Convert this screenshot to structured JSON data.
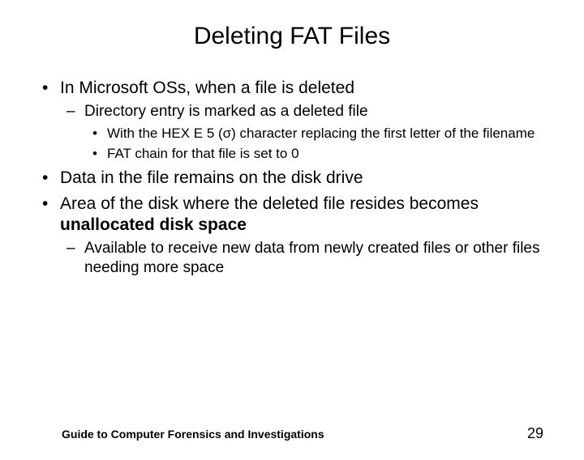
{
  "title": "Deleting FAT Files",
  "bullets": {
    "b1": "In Microsoft OSs, when a file is deleted",
    "b1a": "Directory entry is marked as a deleted file",
    "b1a1": "With the HEX E 5 (σ) character replacing the first letter of the filename",
    "b1a2": "FAT chain for that file is set to 0",
    "b2": "Data in the file remains on the disk drive",
    "b3_pre": "Area of the disk where the deleted file resides becomes ",
    "b3_bold": "unallocated disk space",
    "b3a": "Available to receive new data from newly created files or other files needing more space"
  },
  "footer": {
    "source": "Guide to Computer Forensics and Investigations",
    "page": "29"
  }
}
